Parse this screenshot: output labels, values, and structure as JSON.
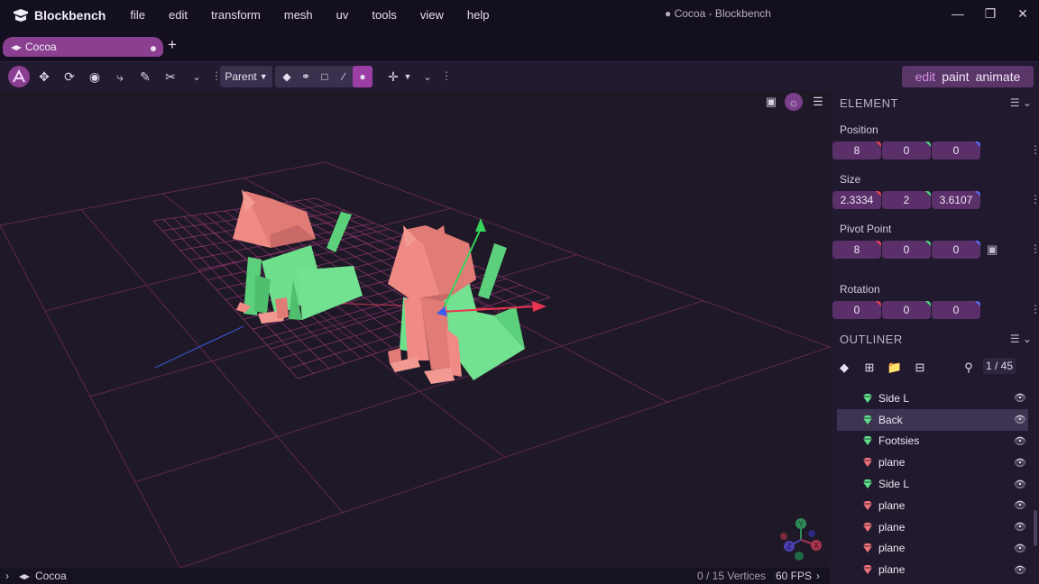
{
  "app": {
    "name": "Blockbench",
    "window_title": "● Cocoa - Blockbench",
    "menu": [
      "file",
      "edit",
      "transform",
      "mesh",
      "uv",
      "tools",
      "view",
      "help"
    ]
  },
  "tabs": [
    {
      "label": "Cocoa"
    }
  ],
  "toolbar": {
    "parent_select": "Parent",
    "modes": [
      "edit",
      "paint",
      "animate"
    ],
    "active_mode": "edit"
  },
  "element_panel": {
    "title": "ELEMENT",
    "position": {
      "label": "Position",
      "x": "8",
      "y": "0",
      "z": "0"
    },
    "size": {
      "label": "Size",
      "x": "2.3334",
      "y": "2",
      "z": "3.6107"
    },
    "pivot": {
      "label": "Pivot Point",
      "x": "8",
      "y": "0",
      "z": "0"
    },
    "rotation": {
      "label": "Rotation",
      "x": "0",
      "y": "0",
      "z": "0"
    }
  },
  "outliner": {
    "title": "OUTLINER",
    "counter": "1 / 45",
    "items": [
      {
        "name": "Side L",
        "color": "#5ee08a",
        "selected": false
      },
      {
        "name": "Back",
        "color": "#5ee08a",
        "selected": true
      },
      {
        "name": "Footsies",
        "color": "#5ee08a",
        "selected": false
      },
      {
        "name": "plane",
        "color": "#f0737a",
        "selected": false
      },
      {
        "name": "Side L",
        "color": "#5ee08a",
        "selected": false
      },
      {
        "name": "plane",
        "color": "#f0737a",
        "selected": false
      },
      {
        "name": "plane",
        "color": "#f0737a",
        "selected": false
      },
      {
        "name": "plane",
        "color": "#f0737a",
        "selected": false
      },
      {
        "name": "plane",
        "color": "#f0737a",
        "selected": false
      }
    ]
  },
  "statusbar": {
    "project": "Cocoa",
    "vertices": "0 / 15 Vertices",
    "fps": "60 FPS"
  },
  "gizmo": {
    "x": "X",
    "y": "Y",
    "z": "Z"
  },
  "colors": {
    "accent": "#8a3f90",
    "field_bg": "#5a2f6a",
    "grid": "#8a3a6a",
    "cat_pink": "#e8827c",
    "cat_green": "#5cd07a"
  }
}
